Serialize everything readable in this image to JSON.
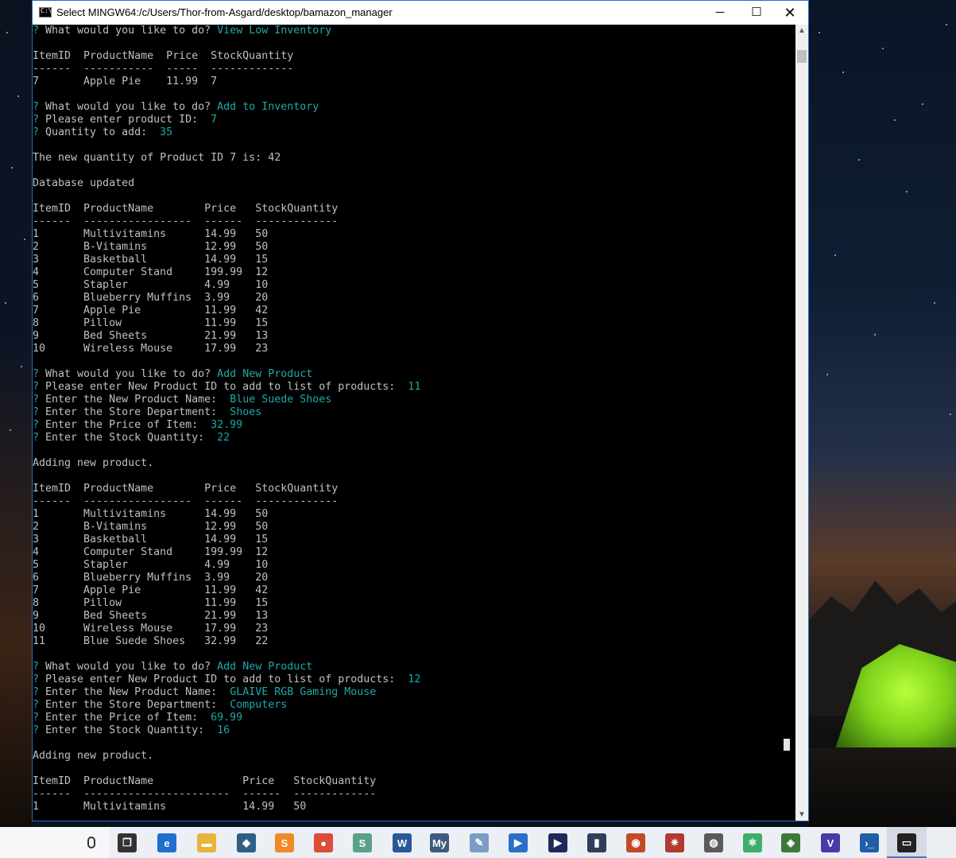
{
  "window": {
    "title": "Select MINGW64:/c/Users/Thor-from-Asgard/desktop/bamazon_manager",
    "minimize": "─",
    "maximize": "☐",
    "close": "✕"
  },
  "terminal": {
    "lines": [
      {
        "prefix": "? ",
        "text": "What would you like to do? ",
        "input": "View Low Inventory"
      },
      {
        "text": ""
      },
      {
        "text": "ItemID  ProductName  Price  StockQuantity"
      },
      {
        "text": "------  -----------  -----  -------------"
      },
      {
        "text": "7       Apple Pie    11.99  7"
      },
      {
        "text": ""
      },
      {
        "prefix": "? ",
        "text": "What would you like to do? ",
        "input": "Add to Inventory"
      },
      {
        "prefix": "? ",
        "text": "Please enter product ID:  ",
        "input": "7"
      },
      {
        "prefix": "? ",
        "text": "Quantity to add:  ",
        "input": "35"
      },
      {
        "text": ""
      },
      {
        "text": "The new quantity of Product ID 7 is: 42"
      },
      {
        "text": ""
      },
      {
        "text": "Database updated"
      },
      {
        "text": ""
      },
      {
        "text": "ItemID  ProductName        Price   StockQuantity"
      },
      {
        "text": "------  -----------------  ------  -------------"
      },
      {
        "text": "1       Multivitamins      14.99   50"
      },
      {
        "text": "2       B-Vitamins         12.99   50"
      },
      {
        "text": "3       Basketball         14.99   15"
      },
      {
        "text": "4       Computer Stand     199.99  12"
      },
      {
        "text": "5       Stapler            4.99    10"
      },
      {
        "text": "6       Blueberry Muffins  3.99    20"
      },
      {
        "text": "7       Apple Pie          11.99   42"
      },
      {
        "text": "8       Pillow             11.99   15"
      },
      {
        "text": "9       Bed Sheets         21.99   13"
      },
      {
        "text": "10      Wireless Mouse     17.99   23"
      },
      {
        "text": ""
      },
      {
        "prefix": "? ",
        "text": "What would you like to do? ",
        "input": "Add New Product"
      },
      {
        "prefix": "? ",
        "text": "Please enter New Product ID to add to list of products:  ",
        "input": "11"
      },
      {
        "prefix": "? ",
        "text": "Enter the New Product Name:  ",
        "input": "Blue Suede Shoes"
      },
      {
        "prefix": "? ",
        "text": "Enter the Store Department:  ",
        "input": "Shoes"
      },
      {
        "prefix": "? ",
        "text": "Enter the Price of Item:  ",
        "input": "32.99"
      },
      {
        "prefix": "? ",
        "text": "Enter the Stock Quantity:  ",
        "input": "22"
      },
      {
        "text": ""
      },
      {
        "text": "Adding new product."
      },
      {
        "text": ""
      },
      {
        "text": "ItemID  ProductName        Price   StockQuantity"
      },
      {
        "text": "------  -----------------  ------  -------------"
      },
      {
        "text": "1       Multivitamins      14.99   50"
      },
      {
        "text": "2       B-Vitamins         12.99   50"
      },
      {
        "text": "3       Basketball         14.99   15"
      },
      {
        "text": "4       Computer Stand     199.99  12"
      },
      {
        "text": "5       Stapler            4.99    10"
      },
      {
        "text": "6       Blueberry Muffins  3.99    20"
      },
      {
        "text": "7       Apple Pie          11.99   42"
      },
      {
        "text": "8       Pillow             11.99   15"
      },
      {
        "text": "9       Bed Sheets         21.99   13"
      },
      {
        "text": "10      Wireless Mouse     17.99   23"
      },
      {
        "text": "11      Blue Suede Shoes   32.99   22"
      },
      {
        "text": ""
      },
      {
        "prefix": "? ",
        "text": "What would you like to do? ",
        "input": "Add New Product"
      },
      {
        "prefix": "? ",
        "text": "Please enter New Product ID to add to list of products:  ",
        "input": "12"
      },
      {
        "prefix": "? ",
        "text": "Enter the New Product Name:  ",
        "input": "GLAIVE RGB Gaming Mouse"
      },
      {
        "prefix": "? ",
        "text": "Enter the Store Department:  ",
        "input": "Computers"
      },
      {
        "prefix": "? ",
        "text": "Enter the Price of Item:  ",
        "input": "69.99"
      },
      {
        "prefix": "? ",
        "text": "Enter the Stock Quantity:  ",
        "input": "16"
      },
      {
        "text": ""
      },
      {
        "text": "Adding new product."
      },
      {
        "text": ""
      },
      {
        "text": "ItemID  ProductName              Price   StockQuantity"
      },
      {
        "text": "------  -----------------------  ------  -------------"
      },
      {
        "text": "1       Multivitamins            14.99   50"
      }
    ]
  },
  "scrollbar": {
    "up": "▲",
    "down": "▼"
  },
  "taskbar": {
    "icons": [
      {
        "name": "task-view-icon",
        "glyph": "❐",
        "color": "#333333"
      },
      {
        "name": "edge-icon",
        "glyph": "e",
        "color": "#1e6fd0"
      },
      {
        "name": "file-explorer-icon",
        "glyph": "▬",
        "color": "#e8b43a"
      },
      {
        "name": "mysql-workbench-icon",
        "glyph": "◆",
        "color": "#2d5f87"
      },
      {
        "name": "sublime-text-icon",
        "glyph": "S",
        "color": "#f08a24"
      },
      {
        "name": "chrome-icon",
        "glyph": "●",
        "color": "#dd4b39"
      },
      {
        "name": "slack-icon",
        "glyph": "S",
        "color": "#5ba08a"
      },
      {
        "name": "word-icon",
        "glyph": "W",
        "color": "#2b579a"
      },
      {
        "name": "mysql-icon",
        "glyph": "My",
        "color": "#3d5a80"
      },
      {
        "name": "paint-icon",
        "glyph": "✎",
        "color": "#7a9cc7"
      },
      {
        "name": "media-player-icon",
        "glyph": "▶",
        "color": "#2a6fc9"
      },
      {
        "name": "media-player-alt-icon",
        "glyph": "▶",
        "color": "#1f2a5a"
      },
      {
        "name": "audio-meter-icon",
        "glyph": "▮",
        "color": "#2f3e59"
      },
      {
        "name": "firefox-icon",
        "glyph": "◉",
        "color": "#c24a27"
      },
      {
        "name": "virtualbox-icon",
        "glyph": "✷",
        "color": "#b33a2f"
      },
      {
        "name": "mongodb-icon",
        "glyph": "◍",
        "color": "#5a5a5a"
      },
      {
        "name": "atom-icon",
        "glyph": "⚛",
        "color": "#3fae6a"
      },
      {
        "name": "layers-icon",
        "glyph": "◈",
        "color": "#3d7a38"
      },
      {
        "name": "visual-studio-icon",
        "glyph": "V",
        "color": "#4a3aa8"
      },
      {
        "name": "powershell-icon",
        "glyph": "›_",
        "color": "#1f5fa8"
      },
      {
        "name": "git-bash-icon",
        "glyph": "▭",
        "color": "#222222"
      }
    ]
  }
}
